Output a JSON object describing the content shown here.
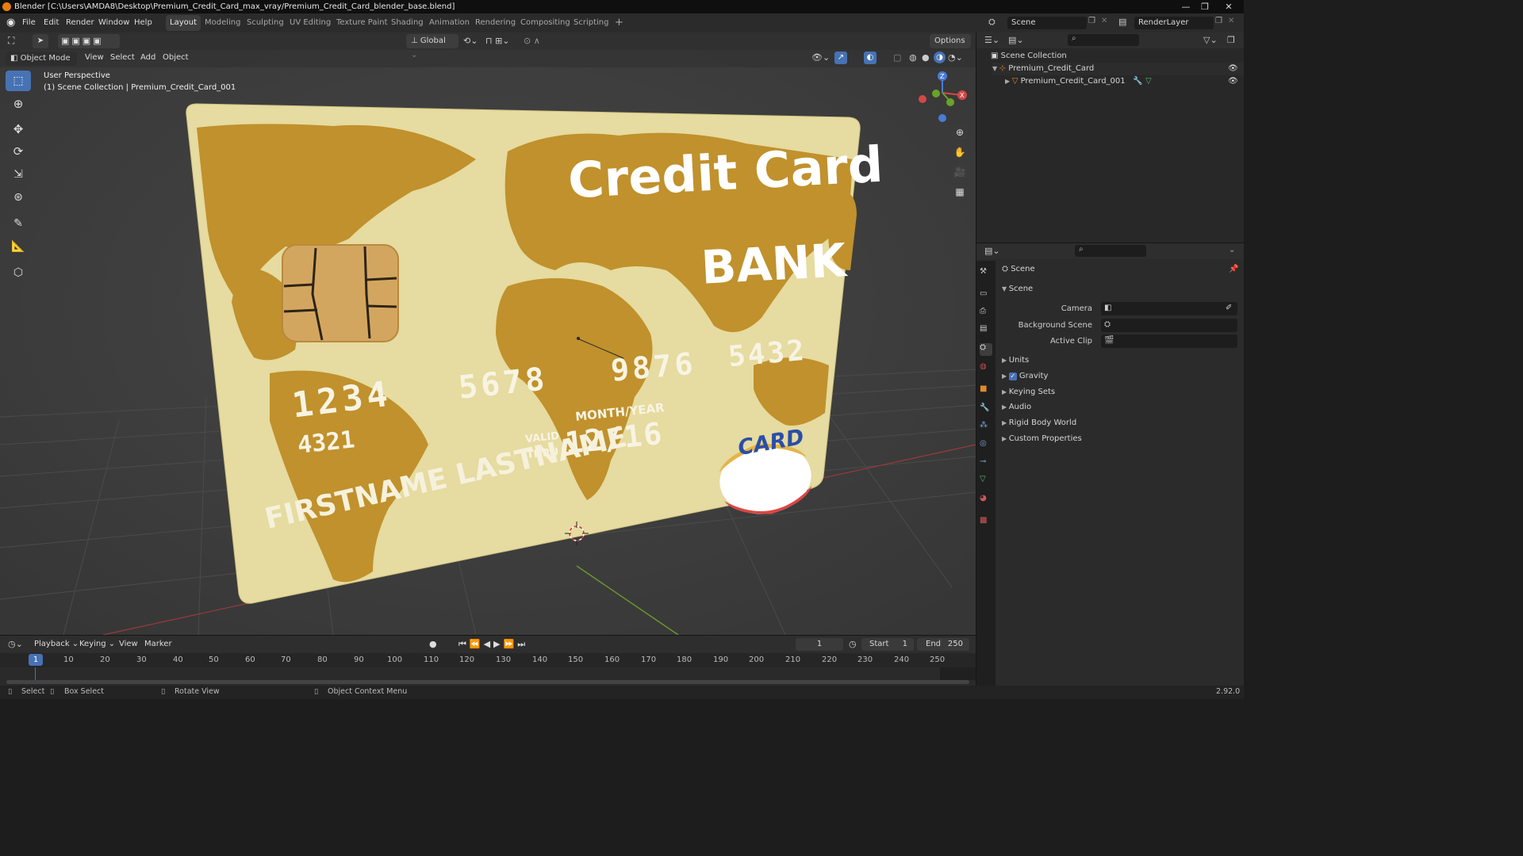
{
  "window": {
    "title": "Blender [C:\\Users\\AMDA8\\Desktop\\Premium_Credit_Card_max_vray/Premium_Credit_Card_blender_base.blend]"
  },
  "menus": [
    "File",
    "Edit",
    "Render",
    "Window",
    "Help"
  ],
  "workspaces": [
    "Layout",
    "Modeling",
    "Sculpting",
    "UV Editing",
    "Texture Paint",
    "Shading",
    "Animation",
    "Rendering",
    "Compositing",
    "Scripting"
  ],
  "active_workspace": "Layout",
  "topbar": {
    "scene": "Scene",
    "view_layer": "RenderLayer"
  },
  "viewport_header": {
    "mode": "Object Mode",
    "menus": [
      "View",
      "Select",
      "Add",
      "Object"
    ],
    "orientation": "Global",
    "options": "Options"
  },
  "viewport_overlay": {
    "line1": "User Perspective",
    "line2": "(1) Scene Collection | Premium_Credit_Card_001"
  },
  "card": {
    "title": "Credit Card",
    "bank": "BANK",
    "num1": "1234",
    "num2": "5678",
    "num3": "9876",
    "num4": "5432",
    "sub": "4321",
    "month_year": "MONTH/YEAR",
    "valid": "VALID",
    "thru": "THRU",
    "expiry": "12/16",
    "name": "FIRSTNAME LASTNAME",
    "badge": "CARD"
  },
  "outliner": {
    "root": "Scene Collection",
    "items": [
      {
        "label": "Premium_Credit_Card"
      },
      {
        "label": "Premium_Credit_Card_001"
      }
    ]
  },
  "properties": {
    "context": "Scene",
    "panel": "Scene",
    "fields": [
      {
        "label": "Camera"
      },
      {
        "label": "Background Scene"
      },
      {
        "label": "Active Clip"
      }
    ],
    "sections": [
      {
        "label": "Units"
      },
      {
        "label": "Gravity",
        "checked": true
      },
      {
        "label": "Keying Sets"
      },
      {
        "label": "Audio"
      },
      {
        "label": "Rigid Body World"
      },
      {
        "label": "Custom Properties"
      }
    ]
  },
  "timeline": {
    "menus": [
      "Playback",
      "Keying",
      "View",
      "Marker"
    ],
    "current_frame": "1",
    "start_label": "Start",
    "start": "1",
    "end_label": "End",
    "end": "250",
    "ticks": [
      "1",
      "10",
      "20",
      "30",
      "40",
      "50",
      "60",
      "70",
      "80",
      "90",
      "100",
      "110",
      "120",
      "130",
      "140",
      "150",
      "160",
      "170",
      "180",
      "190",
      "200",
      "210",
      "220",
      "230",
      "240",
      "250"
    ]
  },
  "statusbar": {
    "select": "Select",
    "box_select": "Box Select",
    "rotate": "Rotate View",
    "context_menu": "Object Context Menu",
    "version": "2.92.0"
  },
  "colors": {
    "accent": "#4772b3",
    "card_bg": "#e6dba0",
    "card_map": "#c0912c"
  }
}
